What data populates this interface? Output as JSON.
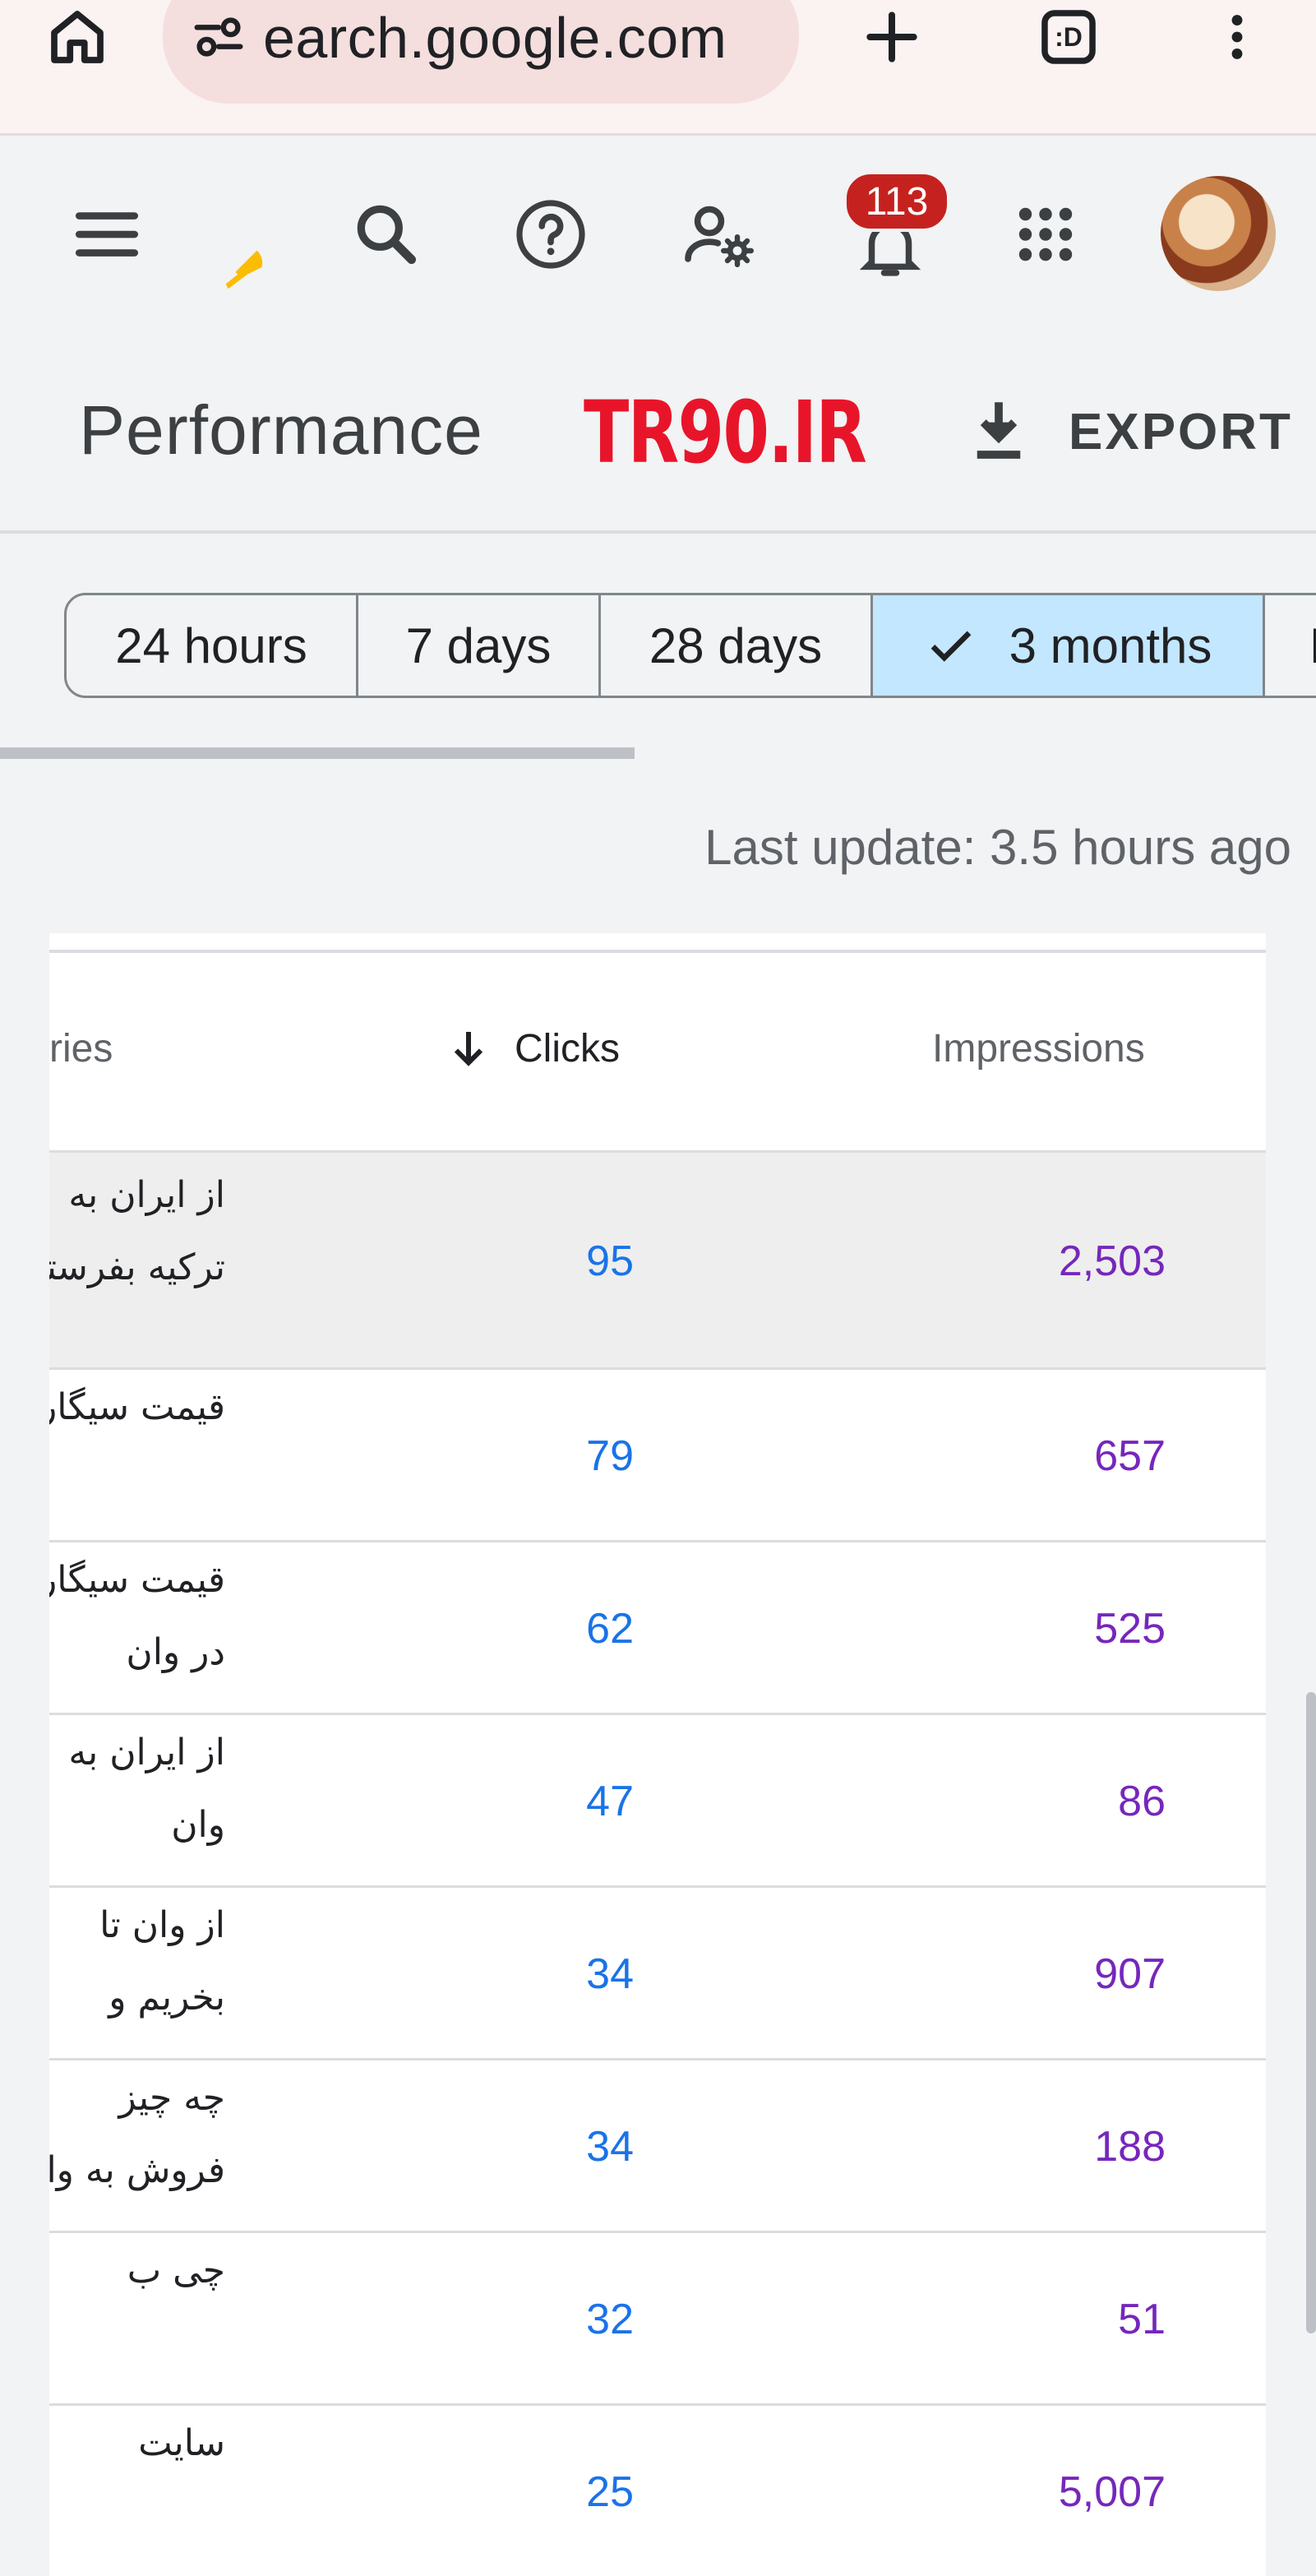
{
  "browser": {
    "url": "earch.google.com",
    "tab_label": ":D",
    "icons": [
      "home-icon",
      "site-settings-icon",
      "new-tab-icon",
      "tab-switcher-icon",
      "more-vert-icon"
    ]
  },
  "header": {
    "notification_count": "113",
    "icons": [
      "menu-icon",
      "search-icon",
      "help-icon",
      "manage-users-icon",
      "notifications-icon",
      "apps-grid-icon"
    ],
    "accent": "#fbbc04"
  },
  "title": {
    "page_title": "Performance",
    "watermark": "TR90.IR",
    "export_label": "EXPORT"
  },
  "date_ranges": [
    {
      "label": "24 hours",
      "selected": false
    },
    {
      "label": "7 days",
      "selected": false
    },
    {
      "label": "28 days",
      "selected": false
    },
    {
      "label": "3 months",
      "selected": true
    },
    {
      "label": "N",
      "selected": false
    }
  ],
  "last_update": "Last update: 3.5 hours ago",
  "table": {
    "columns": {
      "queries": "ries",
      "clicks": "Clicks",
      "impressions": "Impressions"
    },
    "rows": [
      {
        "query_line1": "از ایران به",
        "query_line2": "ترکیه بفرستم",
        "clicks": "95",
        "impressions": "2,503"
      },
      {
        "query_line1": "قیمت سیگار",
        "query_line2": "",
        "clicks": "79",
        "impressions": "657"
      },
      {
        "query_line1": "قیمت سیگار",
        "query_line2": "در وان",
        "clicks": "62",
        "impressions": "525"
      },
      {
        "query_line1": "از ایران به",
        "query_line2": "وان",
        "clicks": "47",
        "impressions": "86"
      },
      {
        "query_line1": "از وان تا",
        "query_line2": "بخریم و",
        "clicks": "34",
        "impressions": "907"
      },
      {
        "query_line1": "چه چیز",
        "query_line2": "فروش به وان",
        "clicks": "34",
        "impressions": "188"
      },
      {
        "query_line1": "چی ب",
        "query_line2": "",
        "clicks": "32",
        "impressions": "51"
      },
      {
        "query_line1": "",
        "query_line2": "سایت",
        "clicks": "25",
        "impressions": "5,007"
      }
    ]
  },
  "colors": {
    "clicks": "#1a73e8",
    "impressions": "#7627bb",
    "selected_chip": "#c2e7ff",
    "badge": "#c5221f"
  }
}
